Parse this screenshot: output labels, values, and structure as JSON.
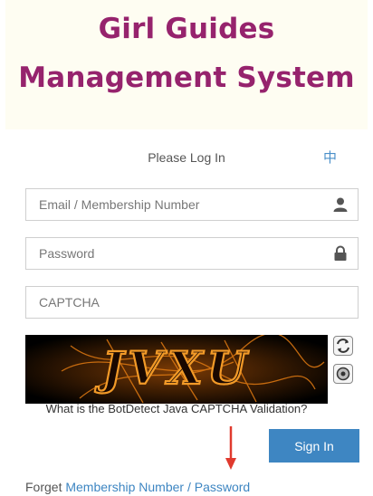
{
  "header": {
    "title_line1": "Girl Guides",
    "title_line2": "Management System"
  },
  "login": {
    "prompt": "Please Log In",
    "language_toggle": "中"
  },
  "form": {
    "email_placeholder": "Email / Membership Number",
    "password_placeholder": "Password",
    "captcha_placeholder": "CAPTCHA",
    "captcha_image_text": "JVXU",
    "captcha_caption": "What is the BotDetect Java CAPTCHA Validation?",
    "sign_in_label": "Sign In"
  },
  "footer": {
    "forget_prefix": "Forget",
    "membership_link": "Membership Number",
    "separator": "/",
    "password_link": "Password"
  },
  "colors": {
    "title": "#96236d",
    "banner_bg": "#fefdf2",
    "button": "#3e86c2",
    "link": "#3e86c2",
    "arrow": "#e03a2e"
  },
  "icons": {
    "email": "user-icon",
    "password": "lock-icon",
    "reload": "reload-icon",
    "sound": "speaker-icon"
  }
}
